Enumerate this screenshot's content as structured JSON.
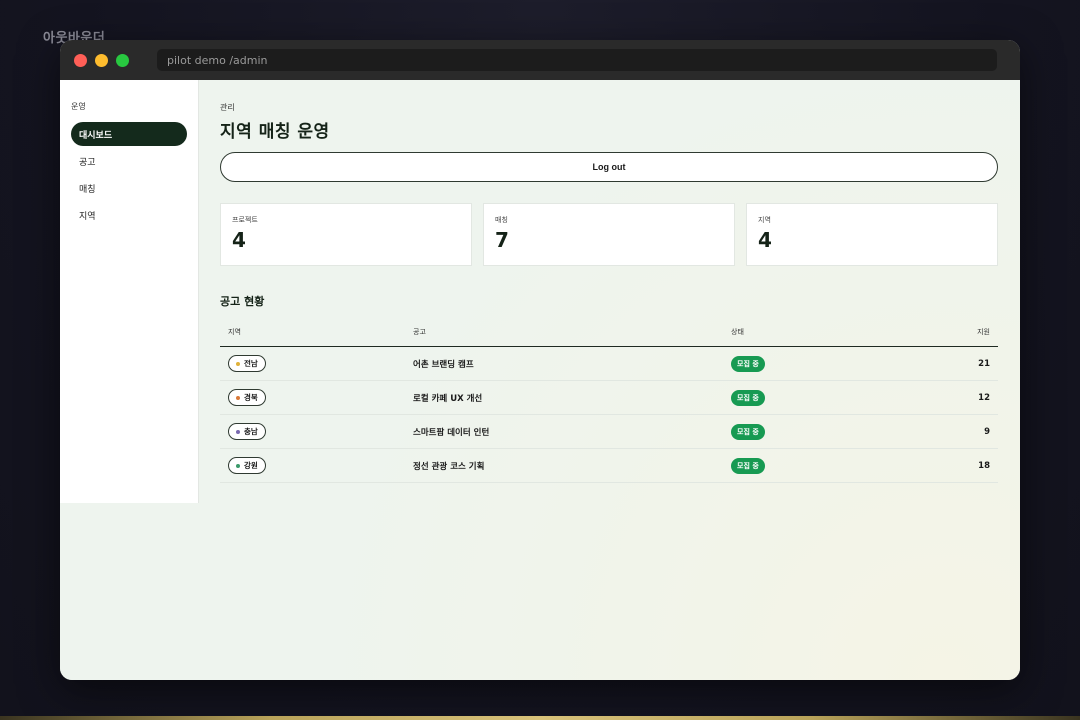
{
  "brand": "아웃바운더",
  "window": {
    "url": "pilot demo /admin"
  },
  "sidebar": {
    "heading": "운영",
    "items": [
      {
        "label": "대시보드",
        "active": true
      },
      {
        "label": "공고",
        "active": false
      },
      {
        "label": "매칭",
        "active": false
      },
      {
        "label": "지역",
        "active": false
      }
    ]
  },
  "header": {
    "eyebrow": "관리",
    "title": "지역 매칭 운영",
    "logout_label": "Log out"
  },
  "stats": [
    {
      "label": "프로젝트",
      "value": "4"
    },
    {
      "label": "매칭",
      "value": "7"
    },
    {
      "label": "지역",
      "value": "4"
    }
  ],
  "section": {
    "title": "공고 현황"
  },
  "table": {
    "columns": [
      "지역",
      "공고",
      "상태",
      "지원"
    ],
    "rows": [
      {
        "region": "전남",
        "title": "어촌 브랜딩 캠프",
        "status": "모집 중",
        "applicants": "21",
        "dot_color": "#e0b23a"
      },
      {
        "region": "경북",
        "title": "로컬 카페 UX 개선",
        "status": "모집 중",
        "applicants": "12",
        "dot_color": "#d97a3a"
      },
      {
        "region": "충남",
        "title": "스마트팜 데이터 인턴",
        "status": "모집 중",
        "applicants": "9",
        "dot_color": "#7a6ab0"
      },
      {
        "region": "강원",
        "title": "정선 관광 코스 기획",
        "status": "모집 중",
        "applicants": "18",
        "dot_color": "#3a9a6a"
      }
    ]
  },
  "colors": {
    "accent_dark": "#142a1c",
    "status_green": "#179a52"
  }
}
